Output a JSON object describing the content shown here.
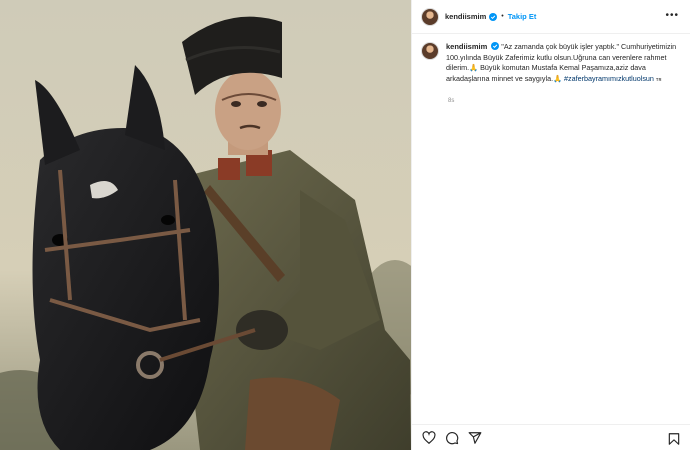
{
  "post": {
    "username": "kendiismim",
    "follow_label": "Takip Et",
    "separator": "•",
    "more_label": "•••",
    "caption_line1": "\"Az zamanda çok büyük işler yaptık.\"",
    "caption_body": "Cumhuriyetimizin 100.yılında Büyük Zaferimiz kutlu olsun.Uğruna can verenlere rahmet dilerim.🙏 Büyük komutan Mustafa Kemal Paşamıza,aziz dava arkadaşlarına minnet ve saygıyla.🙏",
    "hashtag": "#zaferbayramımızkutluolsun",
    "translate_mark": "ᴛʀ",
    "time": "8s"
  },
  "icons": {
    "like": "heart-icon",
    "comment": "comment-icon",
    "share": "send-icon",
    "save": "bookmark-icon",
    "verified": "verified-badge-icon"
  },
  "colors": {
    "link_blue": "#0095f6",
    "hashtag": "#00376b",
    "text": "#262626",
    "muted": "#8e8e8e"
  }
}
